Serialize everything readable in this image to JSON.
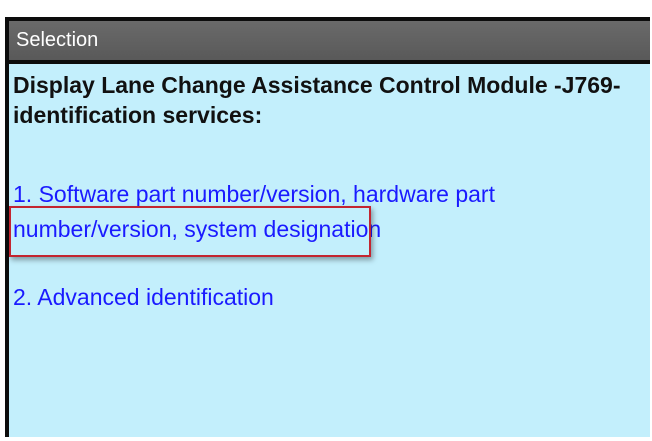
{
  "window": {
    "title": "Selection"
  },
  "content": {
    "heading": "Display Lane Change Assistance Control Module -J769- identification services:",
    "options": [
      {
        "label": "1. Software part number/version, hardware part number/version, system designation"
      },
      {
        "label": "2. Advanced identification"
      }
    ]
  },
  "colors": {
    "title_bar": "#5f5f5f",
    "content_background": "#c3effc",
    "option_text": "#1a1aff",
    "highlight_border": "#c32530"
  }
}
